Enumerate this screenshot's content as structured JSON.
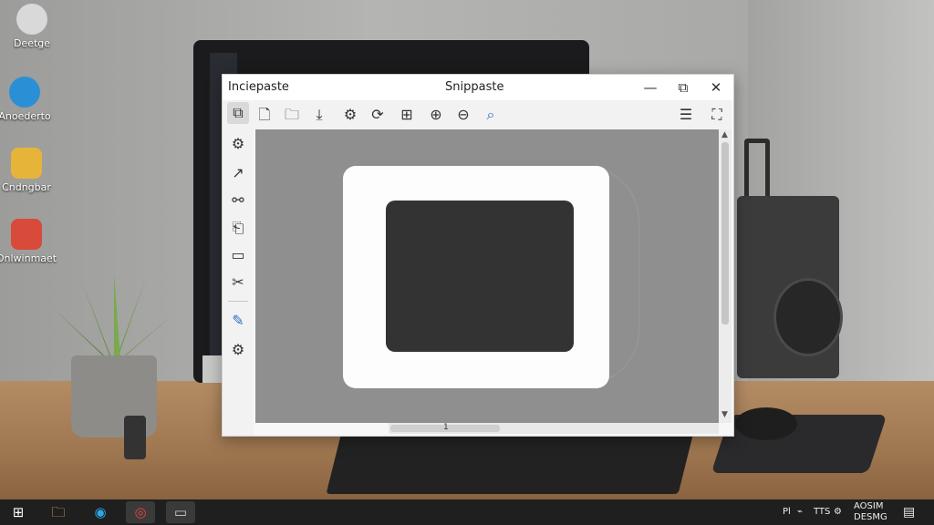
{
  "desktop": {
    "icons": [
      {
        "label": "Deetge",
        "color": "#d9d9d9"
      },
      {
        "label": "Anoederto",
        "color": "#2b8fd6"
      },
      {
        "label": "Cndngbar",
        "color": "#e7b43a"
      },
      {
        "label": "Onlwinmaet",
        "color": "#d84a3a"
      }
    ]
  },
  "window": {
    "title_left": "Inciepaste",
    "title_center": "Snippaste",
    "controls": {
      "minimize": "—",
      "maximize": "⧉",
      "close": "✕"
    },
    "toolbar": [
      {
        "name": "copy-icon",
        "glyph": "⧉"
      },
      {
        "name": "document-icon",
        "glyph": "🗋"
      },
      {
        "name": "folder-icon",
        "glyph": "🗀"
      },
      {
        "name": "import-icon",
        "glyph": "⤓"
      },
      {
        "name": "settings-icon",
        "glyph": "⚙"
      },
      {
        "name": "refresh-icon",
        "glyph": "⟳"
      },
      {
        "name": "grid-icon",
        "glyph": "⊞"
      },
      {
        "name": "zoom-in-icon",
        "glyph": "⊕"
      },
      {
        "name": "zoom-out-icon",
        "glyph": "⊖"
      },
      {
        "name": "search-icon",
        "glyph": "⌕"
      },
      {
        "name": "menu-icon",
        "glyph": "☰"
      },
      {
        "name": "fullscreen-icon",
        "glyph": "⛶"
      }
    ],
    "sidebar": [
      {
        "name": "select-icon",
        "glyph": "⧉",
        "active": true
      },
      {
        "name": "gear-icon",
        "glyph": "⚙"
      },
      {
        "name": "arrow-tool-icon",
        "glyph": "↗"
      },
      {
        "name": "link-icon",
        "glyph": "⚯"
      },
      {
        "name": "bookmark-icon",
        "glyph": "⎗"
      },
      {
        "name": "video-icon",
        "glyph": "▭"
      },
      {
        "name": "cut-icon",
        "glyph": "✂"
      },
      {
        "name": "pen-icon",
        "glyph": "✎"
      },
      {
        "name": "settings-icon",
        "glyph": "⚙"
      }
    ],
    "horizontal_scroll_marker": "1"
  },
  "taskbar": {
    "items": [
      {
        "name": "start-icon",
        "glyph": "⊞",
        "color": "#ffffff"
      },
      {
        "name": "file-explorer-icon",
        "glyph": "🗀",
        "color": "#f3c14a"
      },
      {
        "name": "edge-icon",
        "glyph": "◉",
        "color": "#2fa6e8"
      },
      {
        "name": "chrome-icon",
        "glyph": "◎",
        "color": "#e8453c"
      },
      {
        "name": "snippaste-task-icon",
        "glyph": "▭",
        "color": "#cfcfcf"
      }
    ],
    "tray_left": "Pl",
    "tray_mid": "TTS",
    "tray_clock_top": "AOSIM",
    "tray_clock_bottom": "DESMG"
  }
}
